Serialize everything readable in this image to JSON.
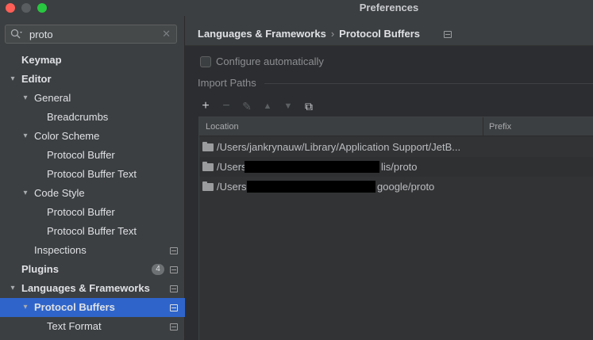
{
  "window": {
    "title": "Preferences"
  },
  "search": {
    "value": "proto"
  },
  "sidebar": {
    "items": [
      {
        "label": "Keymap",
        "bold": true,
        "level": 0,
        "arrow": ""
      },
      {
        "label": "Editor",
        "bold": true,
        "level": 0,
        "arrow": "▾"
      },
      {
        "label": "General",
        "bold": false,
        "level": 1,
        "arrow": "▾"
      },
      {
        "label": "Breadcrumbs",
        "bold": false,
        "level": 2,
        "arrow": ""
      },
      {
        "label": "Color Scheme",
        "bold": false,
        "level": 1,
        "arrow": "▾"
      },
      {
        "label": "Protocol Buffer",
        "bold": false,
        "level": 2,
        "arrow": ""
      },
      {
        "label": "Protocol Buffer Text",
        "bold": false,
        "level": 2,
        "arrow": ""
      },
      {
        "label": "Code Style",
        "bold": false,
        "level": 1,
        "arrow": "▾"
      },
      {
        "label": "Protocol Buffer",
        "bold": false,
        "level": 2,
        "arrow": ""
      },
      {
        "label": "Protocol Buffer Text",
        "bold": false,
        "level": 2,
        "arrow": ""
      },
      {
        "label": "Inspections",
        "bold": false,
        "level": 1,
        "arrow": "",
        "project": true
      },
      {
        "label": "Plugins",
        "bold": true,
        "level": 0,
        "arrow": "",
        "badge": "4",
        "project": true
      },
      {
        "label": "Languages & Frameworks",
        "bold": true,
        "level": 0,
        "arrow": "▾",
        "project": true
      },
      {
        "label": "Protocol Buffers",
        "bold": true,
        "level": 1,
        "arrow": "▾",
        "project": true,
        "selected": true
      },
      {
        "label": "Text Format",
        "bold": false,
        "level": 2,
        "arrow": "",
        "project": true
      }
    ]
  },
  "breadcrumb": {
    "parent": "Languages & Frameworks",
    "separator": "›",
    "current": "Protocol Buffers"
  },
  "settings": {
    "configure_label": "Configure automatically",
    "configure_checked": false,
    "import_paths_label": "Import Paths"
  },
  "toolbar": {
    "add_icon": "+",
    "remove_icon": "−",
    "edit_icon": "✎",
    "up_icon": "▲",
    "down_icon": "▼",
    "copy_icon": "⧉"
  },
  "table": {
    "columns": [
      "Location",
      "Prefix"
    ],
    "rows": [
      {
        "location": "/Users/jankrynauw/Library/Application Support/JetB...",
        "prefix": "",
        "redacted": false
      },
      {
        "location": "/Users",
        "suffix": "lis/proto",
        "prefix": "",
        "redacted": true
      },
      {
        "location": "/Users",
        "suffix": "google/proto",
        "prefix": "",
        "redacted": true
      }
    ]
  },
  "colors": {
    "accent_selection": "#2f65ca",
    "close": "#ff5f57",
    "maximize": "#28c840"
  }
}
